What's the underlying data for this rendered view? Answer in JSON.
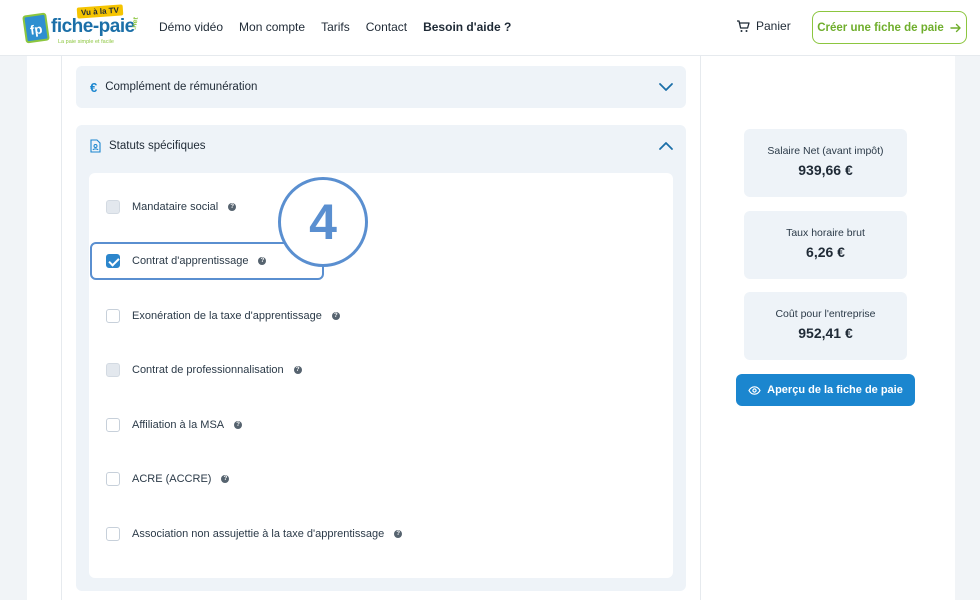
{
  "brand": {
    "name": "fiche-paie",
    "badge": "Vu à la TV",
    "tld": ".net",
    "tagline": "La paie simple et facile",
    "mark": "fp"
  },
  "nav": {
    "items": [
      "Démo vidéo",
      "Mon compte",
      "Tarifs",
      "Contact",
      "Besoin d'aide ?"
    ]
  },
  "cart_label": "Panier",
  "cta_label": "Créer une fiche de paie",
  "sections": {
    "complement": {
      "title": "Complément de rémunération",
      "icon": "euro-icon",
      "expanded": false
    },
    "statuts": {
      "title": "Statuts spécifiques",
      "icon": "document-user-icon",
      "expanded": true
    }
  },
  "options": [
    {
      "label": "Mandataire social",
      "state": "disabled"
    },
    {
      "label": "Contrat d'apprentissage",
      "state": "checked"
    },
    {
      "label": "Exonération de la taxe d'apprentissage",
      "state": "unchecked"
    },
    {
      "label": "Contrat de professionnalisation",
      "state": "disabled"
    },
    {
      "label": "Affiliation à la MSA",
      "state": "unchecked"
    },
    {
      "label": "ACRE (ACCRE)",
      "state": "unchecked"
    },
    {
      "label": "Association non assujettie à la taxe d'apprentissage",
      "state": "unchecked"
    }
  ],
  "step_number": "4",
  "stats": [
    {
      "label": "Salaire Net (avant impôt)",
      "value": "939,66 €"
    },
    {
      "label": "Taux horaire brut",
      "value": "6,26 €"
    },
    {
      "label": "Coût pour l'entreprise",
      "value": "952,41 €"
    }
  ],
  "preview_label": "Aperçu de la fiche de paie",
  "colors": {
    "primary": "#1b86cf",
    "accent_green": "#8cc63f",
    "highlight": "#5a8fd0"
  }
}
